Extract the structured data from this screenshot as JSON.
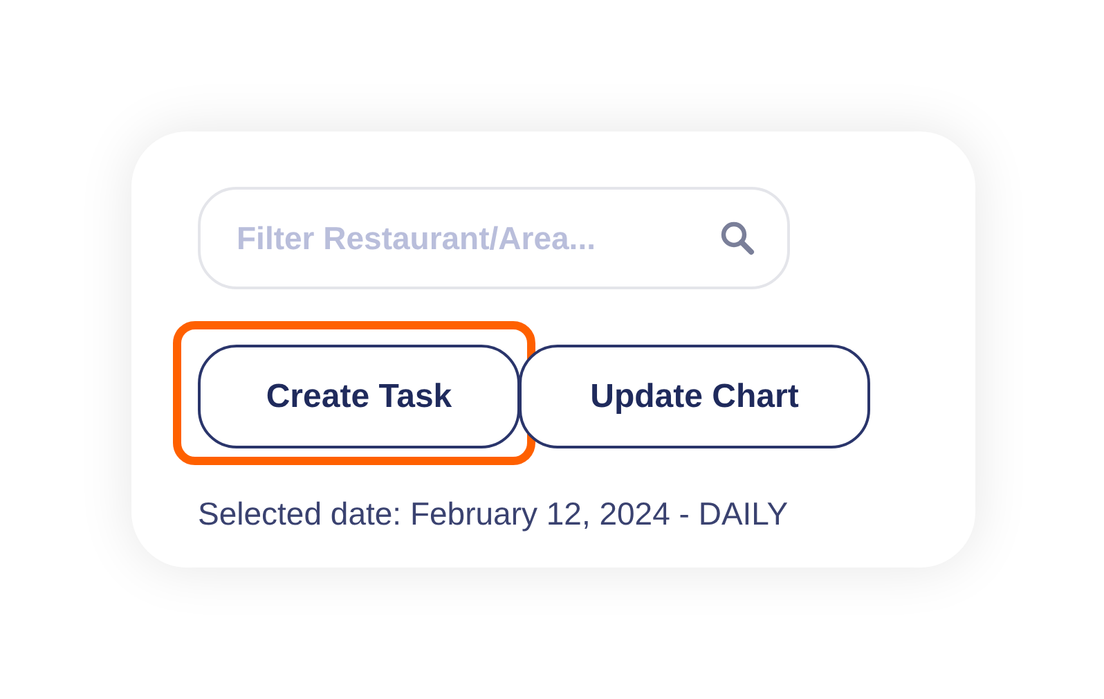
{
  "search": {
    "placeholder": "Filter Restaurant/Area..."
  },
  "buttons": [
    {
      "label": "Create Task",
      "highlighted": true
    },
    {
      "label": "Update Chart",
      "highlighted": false
    }
  ],
  "selected_date": "Selected date: February 12, 2024 - DAILY"
}
